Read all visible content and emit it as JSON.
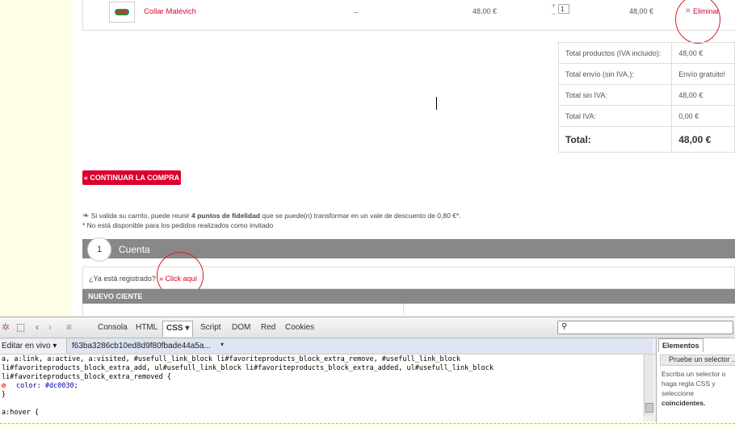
{
  "product": {
    "name": "Collar Malévich",
    "availability": "--",
    "unit_price": "48,00 €",
    "quantity": "1",
    "total": "48,00 €",
    "remove_label": "Eliminar"
  },
  "totals": [
    {
      "label": "Total productos (IVA incluido):",
      "value": "48,00 €"
    },
    {
      "label": "Total envío (sin IVA.):",
      "value": "Envío gratuito!"
    },
    {
      "label": "Total sin IVA:",
      "value": "48,00 €"
    },
    {
      "label": "Total IVA:",
      "value": "0,00 €"
    },
    {
      "label": "Total:",
      "value": "48,00 €"
    }
  ],
  "continue_button": "« CONTINUAR LA COMPRA",
  "loyalty": {
    "pre": "Si valida su carrito, puede reunir ",
    "points": "4 puntos de fidelidad",
    "post": " que se puede(n) transformar en un vale de descuento de 0,80 €*.",
    "note": "* No está disponible para los pedidos realizados como invitado"
  },
  "account": {
    "step": "1",
    "title": "Cuenta",
    "registered_q": "¿Ya está registrado?",
    "click_here": "» Click aquí",
    "new_client": "NUEVO CIENTE"
  },
  "devtools": {
    "tabs": [
      "Consola",
      "HTML",
      "CSS",
      "Script",
      "DOM",
      "Red",
      "Cookies"
    ],
    "active_tab": "CSS",
    "edit_live": "Editar en vivo",
    "stylesheet": "f63ba3286cb10ed8d9f80fbade44a5a...",
    "code_lines": [
      "a, a:link, a:active, a:visited, #usefull_link_block li#favoriteproducts_block_extra_remove, #usefull_link_block",
      "li#favoriteproducts_block_extra_add, ul#usefull_link_block li#favoriteproducts_block_extra_added, ul#usefull_link_block",
      "li#favoriteproducts_block_extra_removed {",
      "color: #dc0030;",
      "}",
      "a:hover {"
    ],
    "side_tab": "Elementos",
    "side_placeholder": "Pruebe un selector ...",
    "side_help_pre": "Escriba un selector o haga regla CSS y seleccione",
    "side_help_bold": "coincidentes."
  },
  "colors": {
    "accent": "#dc0030",
    "bar_gray": "#888888"
  }
}
